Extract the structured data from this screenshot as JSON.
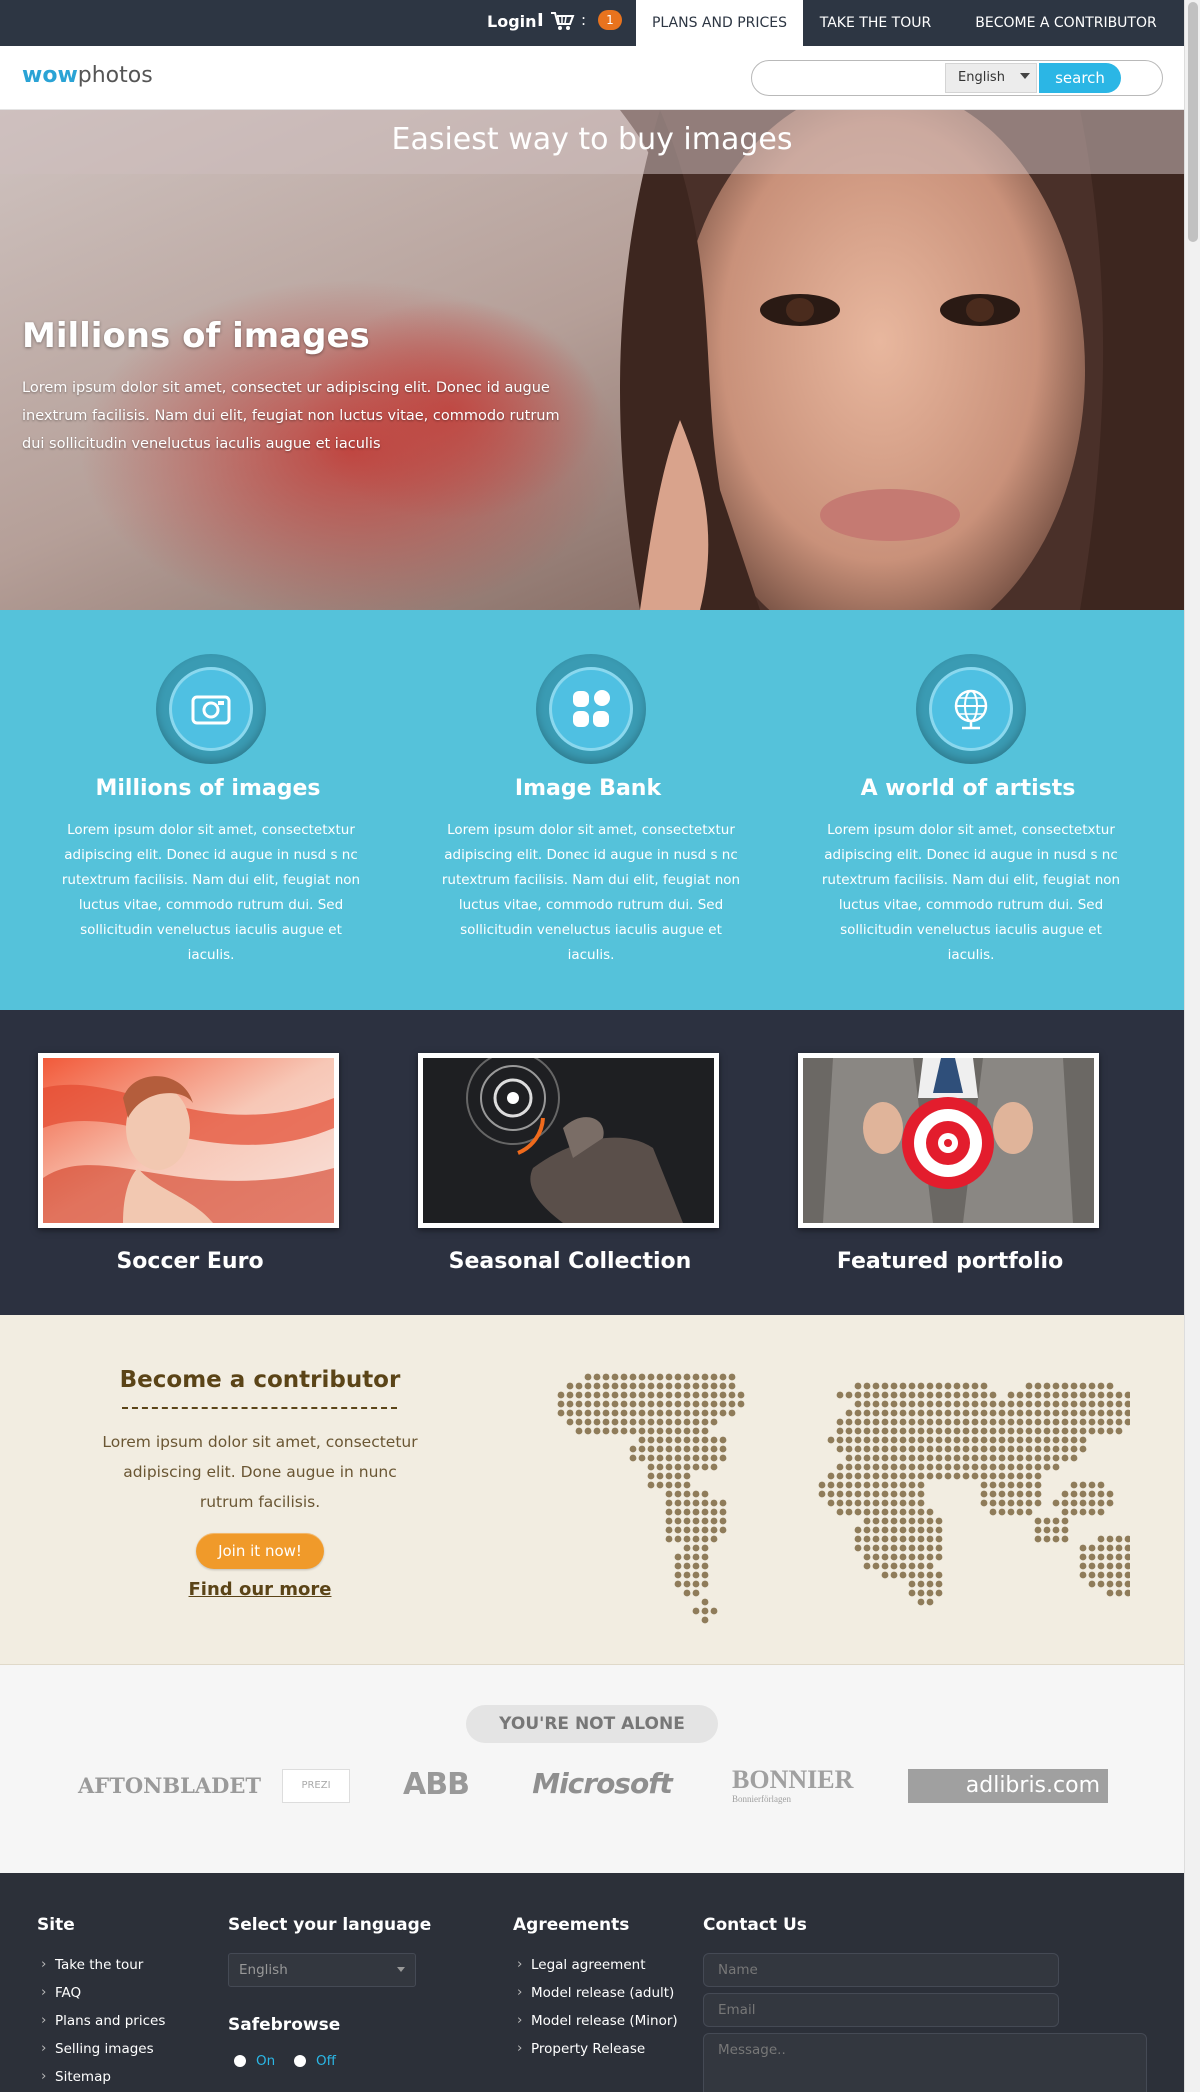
{
  "topbar": {
    "login": "Login",
    "separator": "I",
    "colon": ":",
    "cart_count": "1",
    "nav": [
      "PLANS AND PRICES",
      "TAKE THE TOUR",
      "BECOME A CONTRIBUTOR"
    ],
    "active_nav_index": 0
  },
  "header": {
    "logo_bold": "wow",
    "logo_light": "photos",
    "search_placeholder": "",
    "language": "English",
    "search_button": "search"
  },
  "hero": {
    "banner": "Easiest way to buy images",
    "title": "Millions of images",
    "text": "Lorem ipsum dolor sit amet, consectet ur adipiscing elit. Donec id augue inextrum facilisis. Nam dui elit, feugiat non luctus vitae, commodo rutrum dui sollicitudin veneluctus iaculis augue et iaculis"
  },
  "features": [
    {
      "icon": "camera-icon",
      "title": "Millions of images",
      "text": "Lorem ipsum dolor sit amet, consectetxtur adipiscing elit. Donec id augue in nusd s nc rutextrum facilisis. Nam dui elit, feugiat non luctus vitae, commodo rutrum dui. Sed sollicitudin veneluctus iaculis augue et iaculis."
    },
    {
      "icon": "image-bank-icon",
      "title": "Image Bank",
      "text": "Lorem ipsum dolor sit amet, consectetxtur adipiscing elit. Donec id augue in nusd s nc rutextrum facilisis. Nam dui elit, feugiat non luctus vitae, commodo rutrum dui. Sed sollicitudin veneluctus iaculis augue et iaculis."
    },
    {
      "icon": "globe-icon",
      "title": "A world of artists",
      "text": "Lorem ipsum dolor sit amet, consectetxtur adipiscing elit. Donec id augue in nusd s nc rutextrum facilisis. Nam dui elit, feugiat non luctus vitae, commodo rutrum dui. Sed sollicitudin veneluctus iaculis augue et iaculis."
    }
  ],
  "gallery": [
    {
      "caption": "Soccer Euro"
    },
    {
      "caption": "Seasonal Collection"
    },
    {
      "caption": "Featured portfolio"
    }
  ],
  "contributor": {
    "title": "Become a contributor",
    "text": "Lorem ipsum dolor sit amet, consectetur adipiscing elit. Done augue in nunc rutrum facilisis.",
    "join_button": "Join it now!",
    "find_more": "Find our more"
  },
  "partners": {
    "heading": "YOU'RE NOT ALONE",
    "logos": [
      "AFTONBLADET",
      "PREZI",
      "ABB",
      "Microsoft",
      "BONNIER",
      "Bonnierförlagen",
      "adlibris.com"
    ]
  },
  "footer": {
    "site_title": "Site",
    "site_links": [
      "Take the tour",
      "FAQ",
      "Plans and prices",
      "Selling images",
      "Sitemap"
    ],
    "language_title": "Select your language",
    "language_value": "English",
    "safebrowse_title": "Safebrowse",
    "safebrowse_on": "On",
    "safebrowse_off": "Off",
    "agreements_title": "Agreements",
    "agreement_links": [
      "Legal agreement",
      "Model release (adult)",
      "Model release (Minor)",
      "Property Release"
    ],
    "contact_title": "Contact Us",
    "name_placeholder": "Name",
    "email_placeholder": "Email",
    "message_placeholder": "Message.."
  },
  "colors": {
    "topbar": "#2d3643",
    "accent_blue": "#2bb6e5",
    "features_bg": "#55c2da",
    "gallery_bg": "#2c3140",
    "contrib_bg": "#f2ede1",
    "badge_orange": "#e8731e",
    "footer_bg": "#2c3039"
  }
}
